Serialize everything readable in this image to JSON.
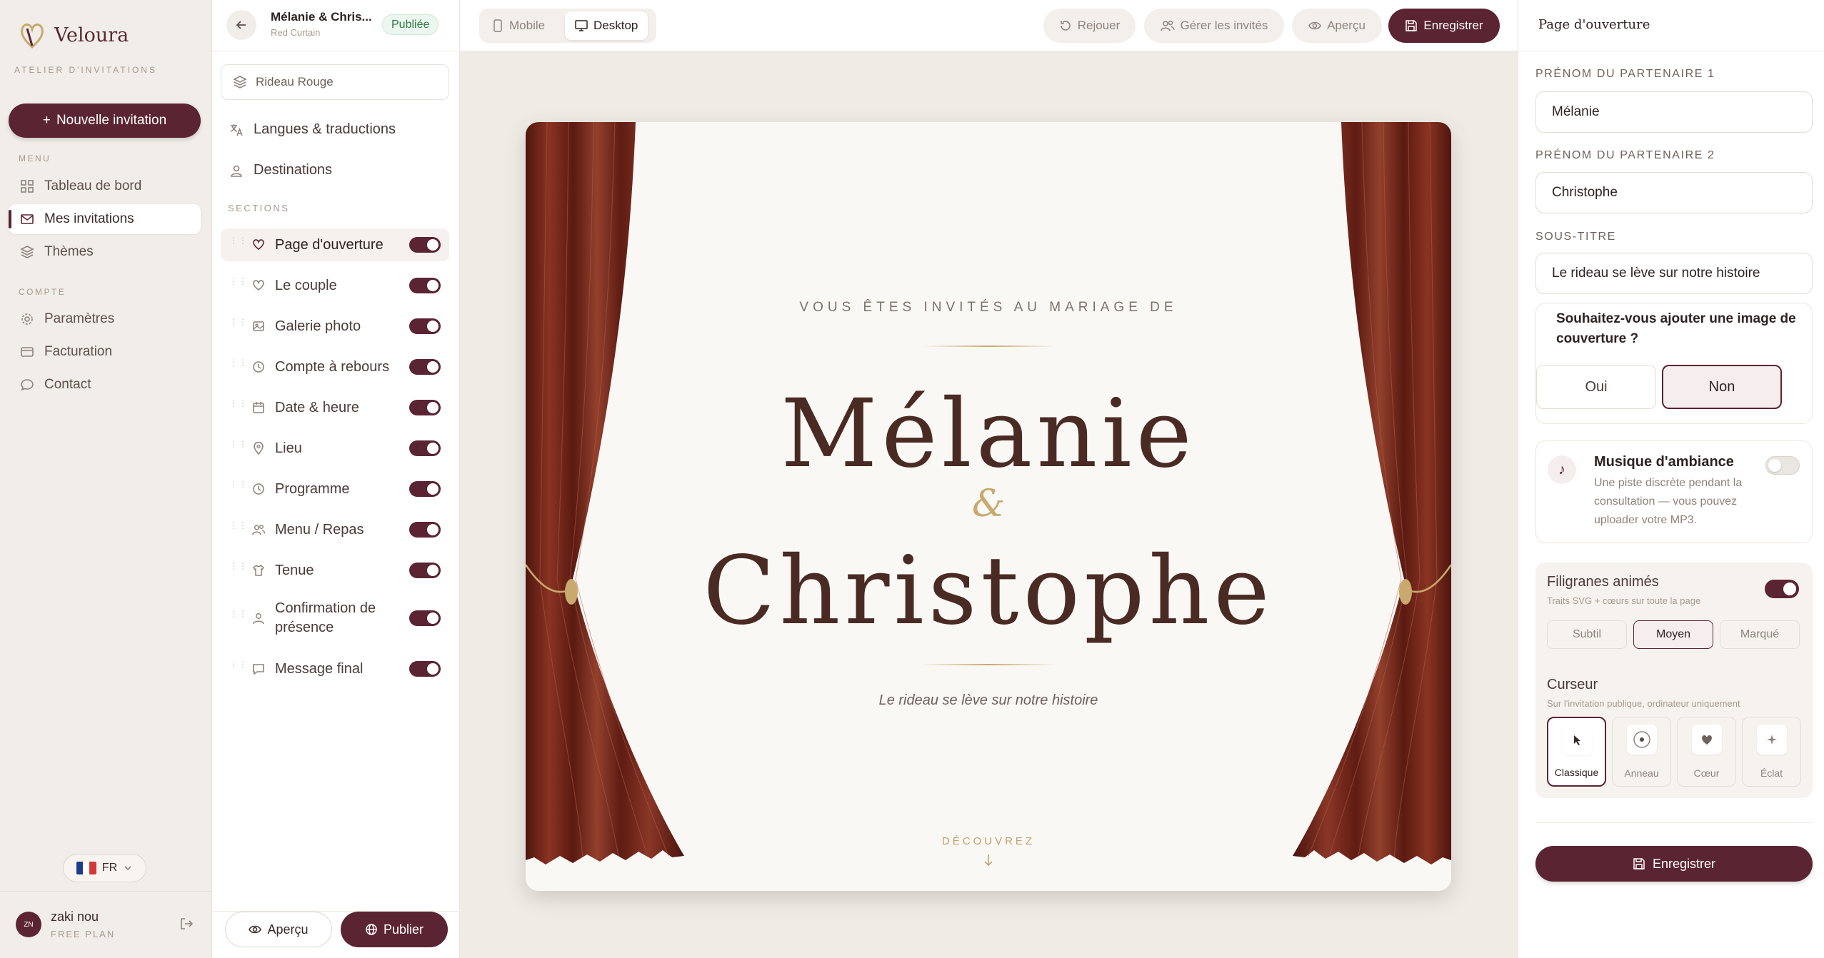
{
  "brand": {
    "name": "Veloura",
    "tagline": "ATELIER D'INVITATIONS",
    "new_invitation": "Nouvelle invitation"
  },
  "nav": {
    "menu_label": "MENU",
    "menu_items": [
      "Tableau de bord",
      "Mes invitations",
      "Thèmes"
    ],
    "account_label": "COMPTE",
    "account_items": [
      "Paramètres",
      "Facturation",
      "Contact"
    ],
    "language": "FR",
    "user": {
      "initials": "ZN",
      "name": "zaki nou",
      "plan": "FREE PLAN"
    }
  },
  "editor": {
    "title": "Mélanie & Chris...",
    "theme_code": "Red Curtain",
    "status": "Publiée",
    "theme_name": "Rideau Rouge",
    "links": [
      "Langues & traductions",
      "Destinations"
    ],
    "sections_label": "SECTIONS",
    "sections": [
      {
        "name": "Page d'ouverture",
        "icon": "heart-icon"
      },
      {
        "name": "Le couple",
        "icon": "heart-icon"
      },
      {
        "name": "Galerie photo",
        "icon": "image-icon"
      },
      {
        "name": "Compte à rebours",
        "icon": "clock-icon"
      },
      {
        "name": "Date & heure",
        "icon": "calendar-icon"
      },
      {
        "name": "Lieu",
        "icon": "location-icon"
      },
      {
        "name": "Programme",
        "icon": "clock-icon"
      },
      {
        "name": "Menu / Repas",
        "icon": "users-icon"
      },
      {
        "name": "Tenue",
        "icon": "shirt-icon"
      },
      {
        "name": "Confirmation de présence",
        "icon": "user-icon"
      },
      {
        "name": "Message final",
        "icon": "message-icon"
      }
    ],
    "preview_label": "Aperçu",
    "publish_label": "Publier"
  },
  "topbar": {
    "mobile": "Mobile",
    "desktop": "Desktop",
    "replay": "Rejouer",
    "guests": "Gérer les invités",
    "preview": "Aperçu",
    "save": "Enregistrer"
  },
  "invitation": {
    "kicker": "VOUS ÊTES INVITÉS AU MARIAGE DE",
    "partner1": "Mélanie",
    "ampersand": "&",
    "partner2": "Christophe",
    "subtitle": "Le rideau se lève sur notre histoire",
    "discover": "DÉCOUVREZ"
  },
  "panel": {
    "title": "Page d'ouverture",
    "partner1_label": "PRÉNOM DU PARTENAIRE 1",
    "partner1_value": "Mélanie",
    "partner2_label": "PRÉNOM DU PARTENAIRE 2",
    "partner2_value": "Christophe",
    "subtitle_label": "SOUS-TITRE",
    "subtitle_value": "Le rideau se lève sur notre histoire",
    "cover_question": "Souhaitez-vous ajouter une image de couverture ?",
    "yes": "Oui",
    "no": "Non",
    "music_title": "Musique d'ambiance",
    "music_desc": "Une piste discrète pendant la consultation — vous pouvez uploader votre MP3.",
    "watermark_title": "Filigranes animés",
    "watermark_sub": "Traits SVG + cœurs sur toute la page",
    "intensities": [
      "Subtil",
      "Moyen",
      "Marqué"
    ],
    "cursor_title": "Curseur",
    "cursor_sub": "Sur l'invitation publique, ordinateur uniquement",
    "cursors": [
      "Classique",
      "Anneau",
      "Cœur",
      "Éclat"
    ],
    "save": "Enregistrer"
  },
  "colors": {
    "accent": "#5b2432",
    "gold": "#c9a96e",
    "curtain": "#6e2418"
  }
}
